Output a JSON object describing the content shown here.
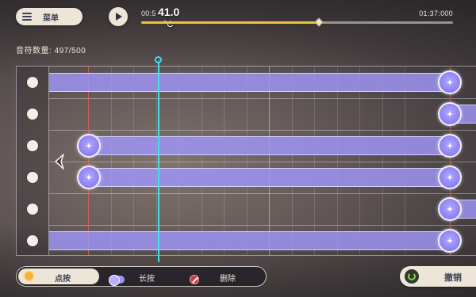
{
  "menu": {
    "label": "菜单",
    "icon": "list-icon"
  },
  "playback": {
    "play_icon": "play-icon",
    "current_time": "00:5",
    "total_time": "01:37:000",
    "progress": 0.57
  },
  "overlay": {
    "temperature": "41.0",
    "unit": "°C"
  },
  "note_count": {
    "label": "音符数量: 497/500"
  },
  "editor": {
    "lanes": 6,
    "playhead_icon": "playhead-knob",
    "back_icon": "chevron-left-icon",
    "colors": {
      "bar": "#a096fa",
      "playhead": "#3fe0e8",
      "accent": "#f0c23a"
    },
    "lane_dot_icon": "lane-dot-icon",
    "node_icon": "star-icon",
    "notes": [
      {
        "lane": 1,
        "start": "left-edge",
        "end_node": true
      },
      {
        "lane": 2,
        "start_node": true,
        "continues": true
      },
      {
        "lane": 3,
        "start_node": true,
        "end_node": true
      },
      {
        "lane": 4,
        "start_node": true,
        "end_node": true
      },
      {
        "lane": 5,
        "start_node": true,
        "continues": true
      },
      {
        "lane": 6,
        "start": "left-edge",
        "end_node": true
      }
    ]
  },
  "toolbar": {
    "tools": [
      {
        "label": "点按",
        "icon": "tap-dot-icon",
        "selected": true
      },
      {
        "label": "长按",
        "icon": "hold-toggle-icon",
        "selected": false
      },
      {
        "label": "删除",
        "icon": "delete-icon",
        "selected": false
      }
    ],
    "undo": {
      "label": "撤销",
      "icon": "undo-icon"
    }
  }
}
